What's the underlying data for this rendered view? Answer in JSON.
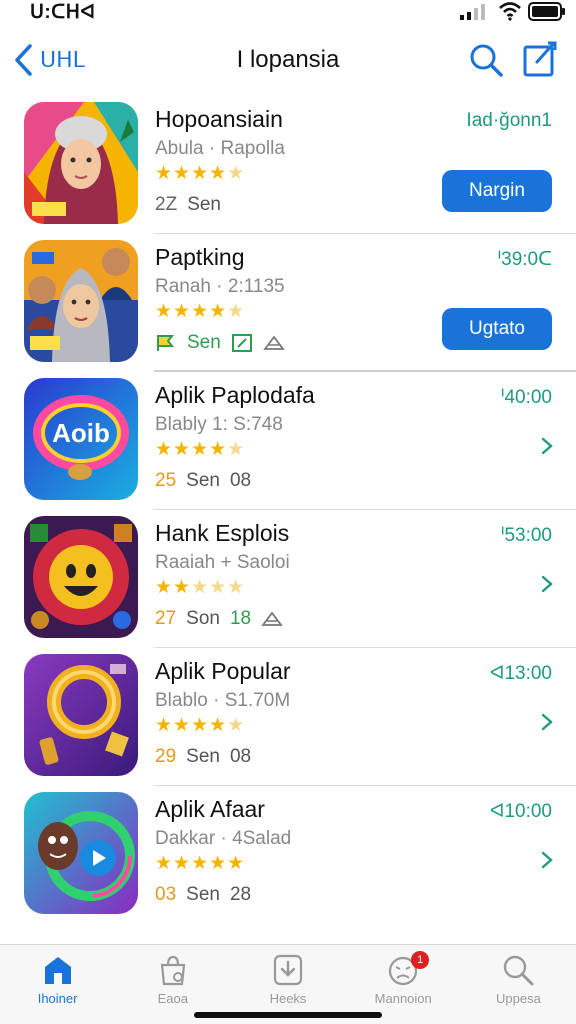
{
  "status_bar": {
    "time": "ᑌ:ᑕᕼᐊ",
    "icons": [
      "signal-icon",
      "wifi-icon",
      "battery-icon"
    ]
  },
  "nav": {
    "back_label": "ᑌᕼᒪ",
    "title": "I lopansia",
    "icons": [
      "back-chevron-icon",
      "search-icon",
      "compose-icon"
    ]
  },
  "colors": {
    "accent": "#1a73d9",
    "star": "#f4b400",
    "time": "#1e9a80",
    "badge": "#e02020"
  },
  "apps": [
    {
      "name": "Hopoansiain",
      "subtitle": "Abula · Rapolla",
      "stars": 4.5,
      "meta_num": "2Z",
      "meta_label": "Sen",
      "meta_extra": "",
      "time": "Iad·ğonn1",
      "action": "Nargin",
      "icon": "hooded-woman-icon"
    },
    {
      "name": "Paptking",
      "subtitle": "Ranah · 2:1135",
      "stars": 4.5,
      "meta_num": "",
      "meta_label": "Sen",
      "meta_extra": "",
      "time": "ᑊ39:0ᑕ",
      "action": "Ugtato",
      "icon": "group-portrait-icon"
    },
    {
      "name": "Aplik Paplodafa",
      "subtitle": "Blably 1: S:748",
      "stars": 4.5,
      "meta_num": "25",
      "meta_label": "Sen",
      "meta_extra": "08",
      "time": "ᑊ40:00",
      "action": "",
      "icon": "aoib-logo-icon"
    },
    {
      "name": "Hank Esplois",
      "subtitle": "Raaiah + Saoloi",
      "stars": 2.5,
      "meta_num": "27",
      "meta_label": "Son",
      "meta_extra": "18",
      "time": "ᑊ53:00",
      "action": "",
      "icon": "smiley-game-icon"
    },
    {
      "name": "Aplik Popular",
      "subtitle": "Blablo · S1.70M",
      "stars": 4.5,
      "meta_num": "29",
      "meta_label": "Sen",
      "meta_extra": "08",
      "time": "ᐊ13:00",
      "action": "",
      "icon": "ring-coins-icon"
    },
    {
      "name": "Aplik Afaar",
      "subtitle": "Dakkar · 4Salad",
      "stars": 5,
      "meta_num": "03",
      "meta_label": "Sen",
      "meta_extra": "28",
      "time": "ᐊ10:00",
      "action": "",
      "icon": "character-play-icon"
    }
  ],
  "tabs": [
    {
      "label": "Ihoiner",
      "icon": "home-icon",
      "active": true,
      "badge": ""
    },
    {
      "label": "Eaoa",
      "icon": "bag-icon",
      "active": false,
      "badge": ""
    },
    {
      "label": "Heeks",
      "icon": "download-icon",
      "active": false,
      "badge": ""
    },
    {
      "label": "Mannoion",
      "icon": "face-icon",
      "active": false,
      "badge": "1"
    },
    {
      "label": "Uppesa",
      "icon": "search-icon",
      "active": false,
      "badge": ""
    }
  ]
}
